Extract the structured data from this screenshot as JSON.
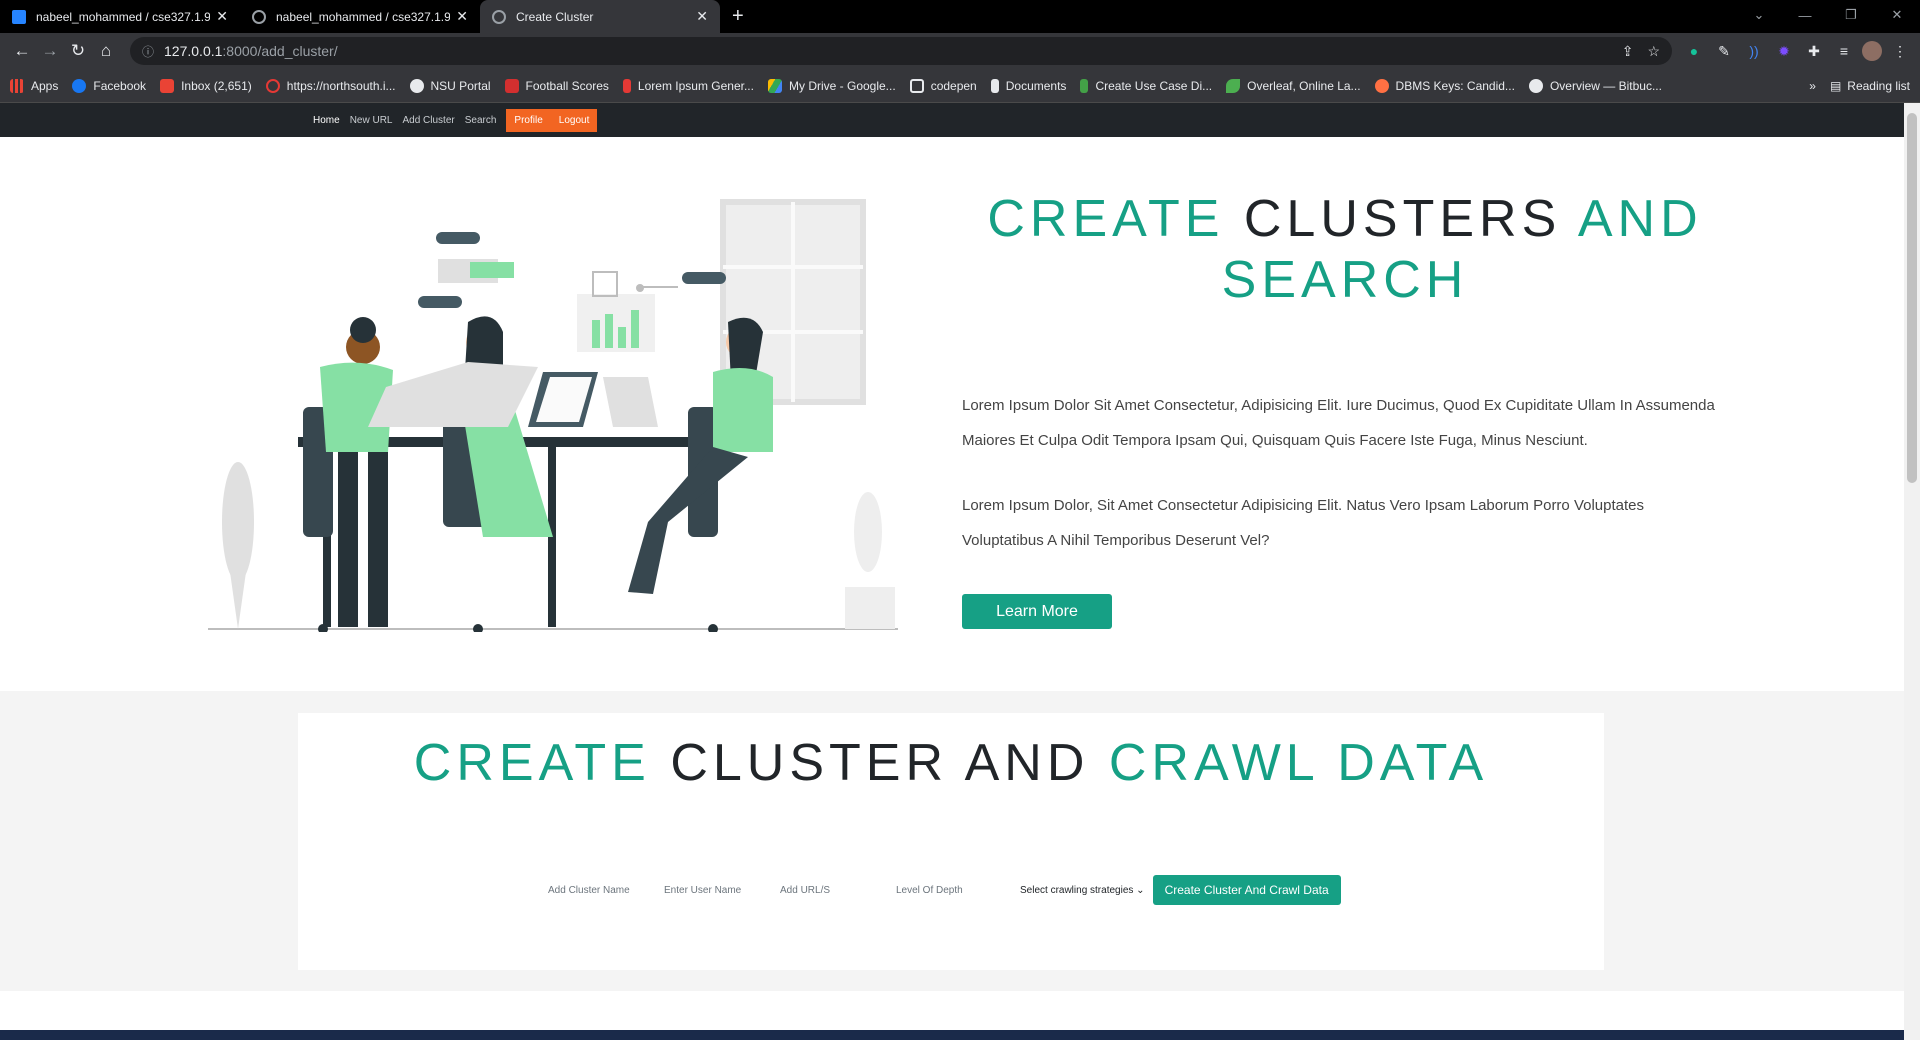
{
  "browser": {
    "tabs": [
      {
        "title": "nabeel_mohammed / cse327.1.9",
        "favicon_color": "#2684ff"
      },
      {
        "title": "nabeel_mohammed / cse327.1.9",
        "favicon_color": "#9aa0a6"
      },
      {
        "title": "Create Cluster",
        "favicon_color": "#9aa0a6"
      }
    ],
    "url_host": "127.0.0.1",
    "url_path": ":8000/add_cluster/",
    "bookmarks": [
      {
        "label": "Apps",
        "color": "#ea4335"
      },
      {
        "label": "Facebook",
        "color": "#1877f2"
      },
      {
        "label": "Inbox (2,651)",
        "color": "#ea4335"
      },
      {
        "label": "https://northsouth.i...",
        "color": "#e53935"
      },
      {
        "label": "NSU Portal",
        "color": "#e8eaed"
      },
      {
        "label": "Football Scores",
        "color": "#d32f2f"
      },
      {
        "label": "Lorem Ipsum Gener...",
        "color": "#e53935"
      },
      {
        "label": "My Drive - Google...",
        "color": "#34a853"
      },
      {
        "label": "codepen",
        "color": "#e8eaed"
      },
      {
        "label": "Documents",
        "color": "#e8eaed"
      },
      {
        "label": "Create Use Case Di...",
        "color": "#43a047"
      },
      {
        "label": "Overleaf, Online La...",
        "color": "#4caf50"
      },
      {
        "label": "DBMS Keys: Candid...",
        "color": "#ff7043"
      },
      {
        "label": "Overview — Bitbuc...",
        "color": "#e8eaed"
      }
    ],
    "bookmarks_more": "»",
    "reading_list": "Reading list"
  },
  "nav": {
    "links": [
      "Home",
      "New URL",
      "Add Cluster",
      "Search"
    ],
    "profile": "Profile",
    "logout": "Logout",
    "accent": "#f26522"
  },
  "hero": {
    "title_a": "CREATE",
    "title_b": "CLUSTERS",
    "title_c": "AND",
    "title_d": "SEARCH",
    "para1_line1": "Lorem Ipsum Dolor Sit Amet Consectetur, Adipisicing Elit. Iure Ducimus, Quod Ex Cupiditate Ullam In Assumenda",
    "para1_line2": "Maiores Et Culpa Odit Tempora Ipsam Qui, Quisquam Quis Facere Iste Fuga, Minus Nesciunt.",
    "para2_line1": "Lorem Ipsum Dolor, Sit Amet Consectetur Adipisicing Elit. Natus Vero Ipsam Laborum Porro Voluptates",
    "para2_line2": "Voluptatibus A Nihil Temporibus Deserunt Vel?",
    "button": "Learn More",
    "accent": "#16a085"
  },
  "crawl": {
    "title_a": "CREATE",
    "title_b": "CLUSTER AND",
    "title_c": "CRAWL DATA",
    "cluster_placeholder": "Add Cluster Name",
    "user_placeholder": "Enter User Name",
    "url_placeholder": "Add URL/S",
    "depth_placeholder": "Level Of Depth",
    "strategy": "Select crawling strategies",
    "submit": "Create Cluster And Crawl Data"
  }
}
